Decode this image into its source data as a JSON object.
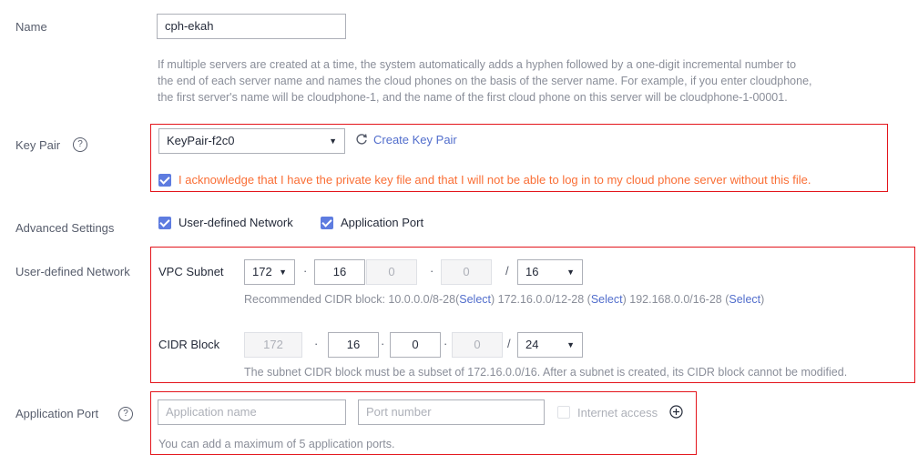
{
  "name": {
    "label": "Name",
    "value": "cph-ekah",
    "hint": [
      "If multiple servers are created at a time, the system automatically adds a hyphen followed by a one-digit incremental number to",
      "the end of each server name and names the cloud phones on the basis of the server name. For example, if you enter cloudphone,",
      "the first server's name will be cloudphone-1, and the name of the first cloud phone on this server will be cloudphone-1-00001."
    ]
  },
  "key_pair": {
    "label": "Key Pair",
    "help_icon": "question-circle-icon",
    "selected": "KeyPair-f2c0",
    "refresh_icon": "refresh-icon",
    "create_link": "Create Key Pair",
    "acknowledge": "I acknowledge that I have the private key file and that I will not be able to log in to my cloud phone server without this file.",
    "acknowledge_checked": true
  },
  "advanced": {
    "label": "Advanced Settings",
    "options": [
      {
        "label": "User-defined Network",
        "checked": true
      },
      {
        "label": "Application Port",
        "checked": true
      }
    ]
  },
  "network": {
    "label": "User-defined Network",
    "vpc_label": "VPC Subnet",
    "vpc": {
      "o1": "172",
      "o2": "16",
      "o3": "0",
      "o4": "0",
      "mask": "16"
    },
    "recommend_prefix": "Recommended CIDR block: 10.0.0.0/8-28 (",
    "recommend_items": [
      {
        "block": "10.0.0.0/8-28",
        "action": "Select"
      },
      {
        "block": "172.16.0.0/12-28",
        "action": "Select"
      },
      {
        "block": "192.168.0.0/16-28",
        "action": "Select"
      }
    ],
    "recommend_label": "Recommended CIDR block:",
    "cidr_label": "CIDR Block",
    "cidr": {
      "o1": "172",
      "o2": "16",
      "o3": "0",
      "o4": "0",
      "mask": "24"
    },
    "cidr_hint": "The subnet CIDR block must be a subset of 172.16.0.0/16. After a subnet is created, its CIDR block cannot be modified."
  },
  "app_port": {
    "label": "Application Port",
    "help_icon": "question-circle-icon",
    "name_placeholder": "Application name",
    "port_placeholder": "Port number",
    "internet_label": "Internet access",
    "add_icon": "plus-circle-icon",
    "hint": "You can add a maximum of 5 application ports."
  },
  "colors": {
    "accent": "#5e7ce0",
    "link": "#526ecc",
    "warning": "#fa6e35",
    "highlight_border": "#e3141b"
  },
  "punctuation": {
    "dot": "·",
    "slash": "/",
    "dropdown": "▼",
    "open_paren": "(",
    "close_paren": ")",
    "help": "?"
  }
}
